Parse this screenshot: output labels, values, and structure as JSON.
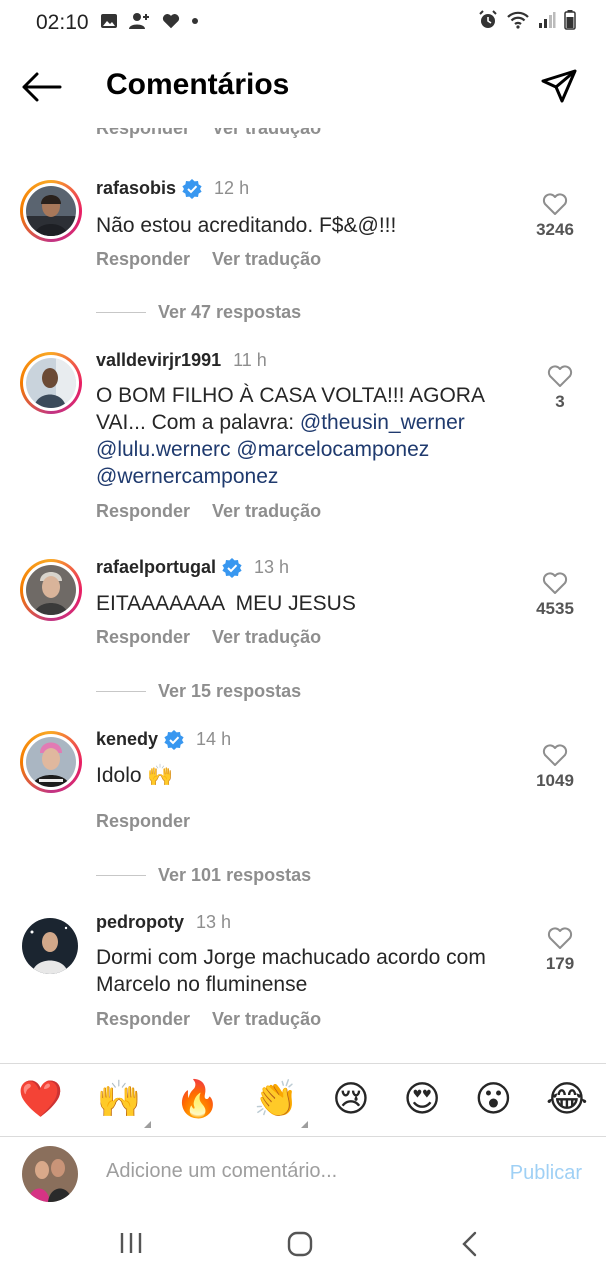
{
  "status": {
    "time": "02:10"
  },
  "header": {
    "title": "Comentários"
  },
  "cut_actions": {
    "reply": "Responder",
    "translate": "Ver tradução"
  },
  "comments": [
    {
      "username": "rafasobis",
      "verified": true,
      "time": "12 h",
      "text": "Não estou acreditando. F$&@!!!",
      "likes": "3246",
      "reply": "Responder",
      "translate": "Ver tradução",
      "replies": "Ver 47 respostas"
    },
    {
      "username": "valldevirjr1991",
      "verified": false,
      "time": "11 h",
      "text_intro": "O BOM FILHO À CASA VOLTA!!! AGORA VAI... Com a palavra:",
      "mentions": [
        "@theusin_werner",
        "@lulu.wernerc",
        "@marcelocamponez",
        "@wernercamponez"
      ],
      "likes": "3",
      "reply": "Responder",
      "translate": "Ver tradução"
    },
    {
      "username": "rafaelportugal",
      "verified": true,
      "time": "13 h",
      "text": "EITAAAAAAA  MEU JESUS",
      "likes": "4535",
      "reply": "Responder",
      "translate": "Ver tradução",
      "replies": "Ver 15 respostas"
    },
    {
      "username": "kenedy",
      "verified": true,
      "time": "14 h",
      "text": "Idolo 🙌",
      "likes": "1049",
      "reply": "Responder",
      "replies": "Ver 101 respostas"
    },
    {
      "username": "pedropoty",
      "verified": false,
      "time": "13 h",
      "text": "Dormi com Jorge machucado acordo com Marcelo no fluminense",
      "likes": "179",
      "reply": "Responder",
      "translate": "Ver tradução"
    }
  ],
  "emoji_bar": [
    "❤️",
    "🙌",
    "🔥",
    "👏",
    "😢",
    "😍",
    "😮",
    "😂"
  ],
  "composer": {
    "placeholder": "Adicione um comentário...",
    "publish": "Publicar"
  }
}
